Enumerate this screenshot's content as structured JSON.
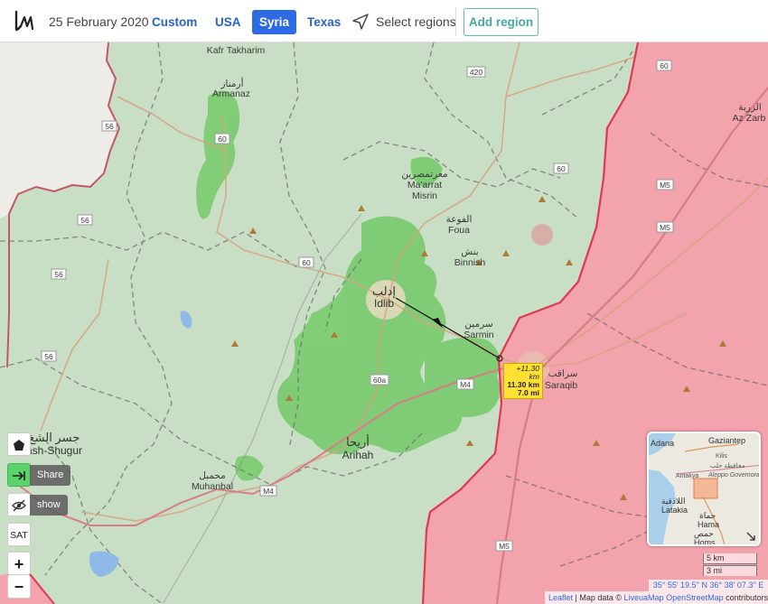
{
  "header": {
    "date": "25 February 2020",
    "tabs": [
      {
        "label": "Custom",
        "active": false
      },
      {
        "label": "USA",
        "active": false
      },
      {
        "label": "Syria",
        "active": true
      },
      {
        "label": "Texas",
        "active": false
      }
    ],
    "select_regions_label": "Select regions",
    "add_region_label": "Add region"
  },
  "map": {
    "cities": {
      "kafr_takharim": "Kafr Takharim",
      "armanaz_ar": "أرمناز",
      "armanaz": "Armanaz",
      "maarrat_ar": "معرتمصرين",
      "maarrat": "Ma'arrat",
      "misrin": "Misrin",
      "foua_ar": "الفوعة",
      "foua": "Foua",
      "binnish_ar": "بنش",
      "binnish": "Binnish",
      "idlib_ar": "إدلب",
      "idlib": "Idlib",
      "sarmin_ar": "سرمين",
      "sarmin": "Sarmin",
      "saraqib_ar": "سراقب",
      "saraqib": "Saraqib",
      "arihah_ar": "أريحا",
      "arihah": "Arihah",
      "muhanbal_ar": "محمبل",
      "muhanbal": "Muhanbal",
      "jisr_ar": "جسر الشغ",
      "jisr": "ash-Shugur",
      "azzarb_ar": "الزربة",
      "azzarb": "Az Zarb"
    },
    "road_labels": {
      "r420": "420",
      "r60a": "60",
      "r60b": "60",
      "r60c": "60",
      "r60d": "60",
      "r56a": "56",
      "r56b": "56",
      "r56c": "56",
      "r56d": "56",
      "rm5a": "M5",
      "rm5b": "M5",
      "rm5c": "M5",
      "rm4a": "M4",
      "rm4b": "M4",
      "r60e": "60a"
    },
    "measure": {
      "delta": "+11.30 km",
      "km": "11.30 km",
      "mi": "7.0 mi"
    },
    "colors": {
      "green_zone": "#c9dfc5",
      "red_zone": "#f2a3ab",
      "border": "#e0394f",
      "forest": "#7dcc72"
    }
  },
  "controls": {
    "share_label": "Share",
    "show_label": "show",
    "sat_label": "SAT",
    "zoom_in": "+",
    "zoom_out": "−"
  },
  "minimap": {
    "adana": "Adana",
    "gaziantep": "Gaziantep",
    "kilis": "Kilis",
    "aleppo_ar": "محافظة حلب",
    "aleppo": "Aleppo Governorate",
    "antakya": "Antakya",
    "latakia_ar": "اللاذقية",
    "latakia": "Latakia",
    "hama_ar": "حماة",
    "hama": "Hama",
    "homs_ar": "حمص",
    "homs": "Homs"
  },
  "scale": {
    "km": "5 km",
    "mi": "3 mi"
  },
  "coords": "35° 55' 19.5'' N 36° 38' 07.3'' E",
  "attribution": {
    "leaflet": "Leaflet",
    "text": " | Map data © ",
    "liveuamap": "LiveuaMap",
    "osm": "OpenStreetMap",
    "tail": " contributors"
  }
}
